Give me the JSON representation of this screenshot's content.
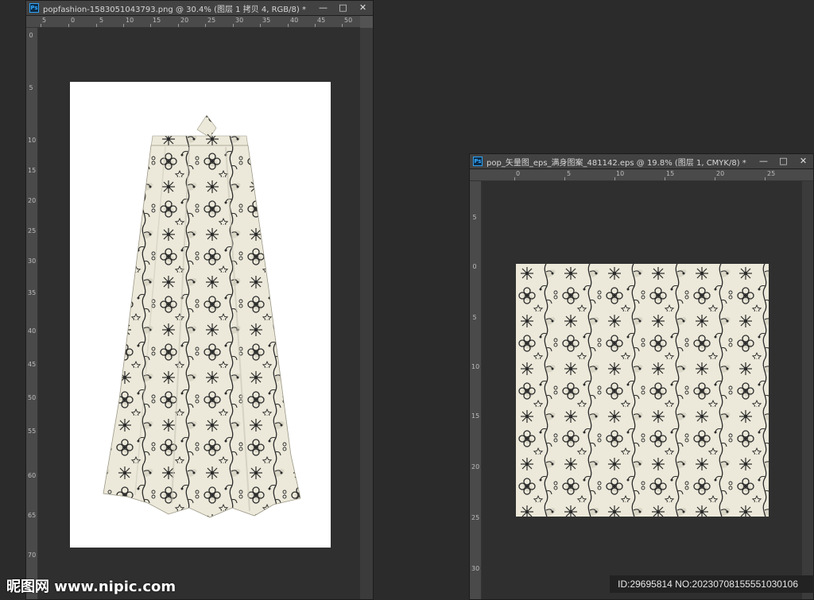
{
  "windows": [
    {
      "title": "popfashion-1583051043793.png @ 30.4% (图层 1 拷贝 4, RGB/8) *",
      "app_icon": "Ps",
      "ruler_h": [
        "5",
        "0",
        "5",
        "10",
        "15",
        "20",
        "25",
        "30",
        "35",
        "40",
        "45",
        "50"
      ],
      "ruler_v": [
        "0",
        "5",
        "10",
        "15",
        "20",
        "25",
        "30",
        "35",
        "40",
        "45",
        "50",
        "55",
        "60",
        "65",
        "70"
      ]
    },
    {
      "title": "pop_矢量图_eps_满身图案_481142.eps @ 19.8% (图层 1, CMYK/8) *",
      "app_icon": "Ps",
      "ruler_h": [
        "0",
        "5",
        "10",
        "15",
        "20",
        "25"
      ],
      "ruler_v": [
        "5",
        "0",
        "5",
        "10",
        "15",
        "20",
        "25",
        "30"
      ]
    }
  ],
  "window_buttons": {
    "minimize": "—",
    "restore": "□",
    "close": "✕"
  },
  "colors": {
    "pattern_bg": "#ece9da",
    "pattern_ink": "#2a2a2a",
    "workspace": "#2b2b2b",
    "panel": "#535353"
  },
  "watermark": {
    "left": "昵图网 www.nipic.com",
    "right": "ID:29695814 NO:20230708155551030106"
  }
}
